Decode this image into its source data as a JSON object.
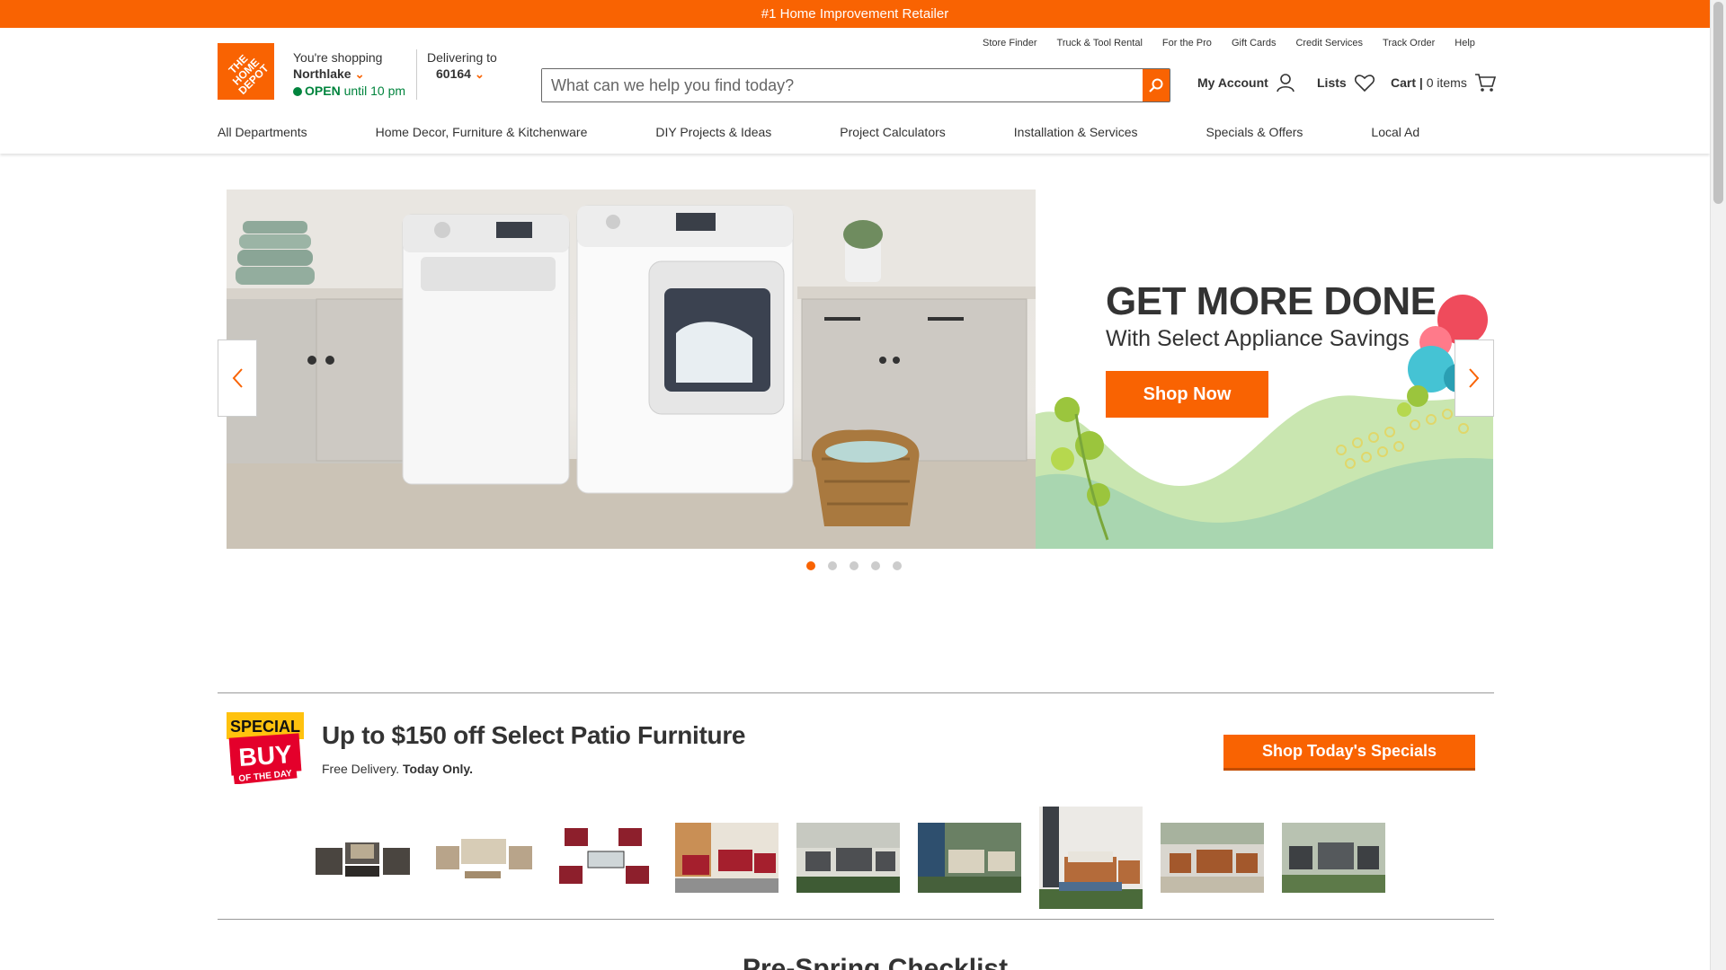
{
  "promo": {
    "text": "#1 Home Improvement Retailer"
  },
  "logo": {
    "text": "THE\nHOME\nDEPOT"
  },
  "store": {
    "label": "You're shopping",
    "name": "Northlake",
    "status": "OPEN",
    "hours": "until 10 pm"
  },
  "delivery": {
    "label": "Delivering to",
    "zip": "60164"
  },
  "util_links": [
    "Store Finder",
    "Truck & Tool Rental",
    "For the Pro",
    "Gift Cards",
    "Credit Services",
    "Track Order",
    "Help"
  ],
  "search": {
    "placeholder": "What can we help you find today?"
  },
  "account": {
    "my_account": "My Account",
    "lists": "Lists",
    "cart": "Cart",
    "cart_sep": "|",
    "cart_count": "0 items"
  },
  "nav": [
    "All Departments",
    "Home Decor, Furniture & Kitchenware",
    "DIY Projects & Ideas",
    "Project Calculators",
    "Installation & Services",
    "Specials & Offers",
    "Local Ad"
  ],
  "hero": {
    "title": "GET MORE DONE",
    "subtitle": "With Select Appliance Savings",
    "cta": "Shop Now",
    "slide_count": 5,
    "active_slide": 1
  },
  "special_buy": {
    "badge_top": "SPECIAL",
    "badge_mid": "BUY",
    "badge_bottom": "OF THE DAY",
    "title": "Up to $150 off Select Patio Furniture",
    "sub_prefix": "Free Delivery.",
    "sub_bold": "Today Only.",
    "cta": "Shop Today's Specials"
  },
  "next_section": {
    "title": "Pre-Spring Checklist"
  },
  "colors": {
    "brand": "#f96302",
    "open": "#00843d",
    "text": "#333333"
  }
}
